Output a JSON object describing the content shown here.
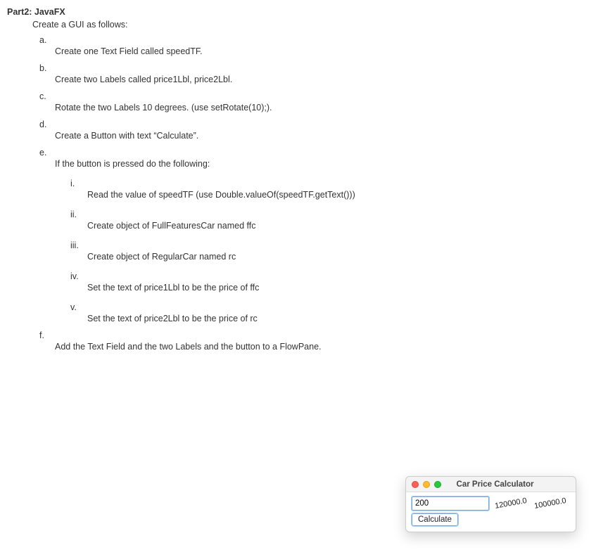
{
  "heading": "Part2: JavaFX",
  "intro": "Create a GUI as follows:",
  "items": {
    "a": {
      "marker": "a.",
      "text": "Create one Text Field called speedTF."
    },
    "b": {
      "marker": "b.",
      "text": "Create two Labels called price1Lbl, price2Lbl."
    },
    "c": {
      "marker": "c.",
      "text": "Rotate the two Labels 10 degrees. (use setRotate(10);)."
    },
    "d": {
      "marker": "d.",
      "text": "Create a Button with text “Calculate”."
    },
    "e": {
      "marker": "e.",
      "text": "If the button is pressed do the following:"
    },
    "f": {
      "marker": "f.",
      "text": "Add the Text Field and the two Labels and the button to a FlowPane."
    }
  },
  "subitems": {
    "i": {
      "marker": "i.",
      "text": "Read the value of speedTF (use Double.valueOf(speedTF.getText()))"
    },
    "ii": {
      "marker": "ii.",
      "text": "Create object of FullFeaturesCar named ffc"
    },
    "iii": {
      "marker": "iii.",
      "text": "Create object of RegularCar named rc"
    },
    "iv": {
      "marker": "iv.",
      "text": "Set the text of price1Lbl to be the price of ffc"
    },
    "v": {
      "marker": "v.",
      "text": "Set the text of price2Lbl to be the price of rc"
    }
  },
  "window": {
    "title": "Car Price Calculator",
    "speed_value": "200",
    "price1": "120000.0",
    "price2": "100000.0",
    "button_label": "Calculate"
  }
}
